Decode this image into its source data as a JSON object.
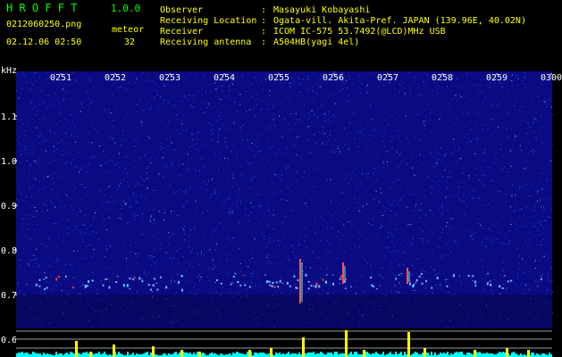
{
  "app": {
    "name": "H R O F F T",
    "version": "1.0.0"
  },
  "file": {
    "name": "0212060250.png",
    "datetime": "02.12.06 02:50"
  },
  "meteor": {
    "label": "meteor",
    "count": "32"
  },
  "info": [
    {
      "label": "Observer",
      "sep": ":",
      "value": "Masayuki Kobayashi"
    },
    {
      "label": "Receiving Location",
      "sep": ":",
      "value": "Ogata-vill. Akita-Pref. JAPAN (139.96E, 40.02N)"
    },
    {
      "label": "Receiver",
      "sep": ":",
      "value": "ICOM IC-575 53.7492(@LCD)MHz USB"
    },
    {
      "label": "Receiving antenna",
      "sep": ":",
      "value": "A504HB(yagi 4el)"
    }
  ],
  "axis": {
    "unit": "kHz",
    "time_ticks": [
      "0251",
      "0252",
      "0253",
      "0254",
      "0255",
      "0256",
      "0257",
      "0258",
      "0259",
      "0300"
    ],
    "freq_ticks": [
      "1.1",
      "1.0",
      "0.9",
      "0.8",
      "0.7",
      "0.6"
    ]
  },
  "colors": {
    "title": "#00ff00",
    "label": "#ffff00",
    "axis": "#ffffff",
    "spectrum_bg": "#0a0a82",
    "noise": "#2a6cff",
    "activity": "#ffff00",
    "baseline": "#00ffff"
  }
}
